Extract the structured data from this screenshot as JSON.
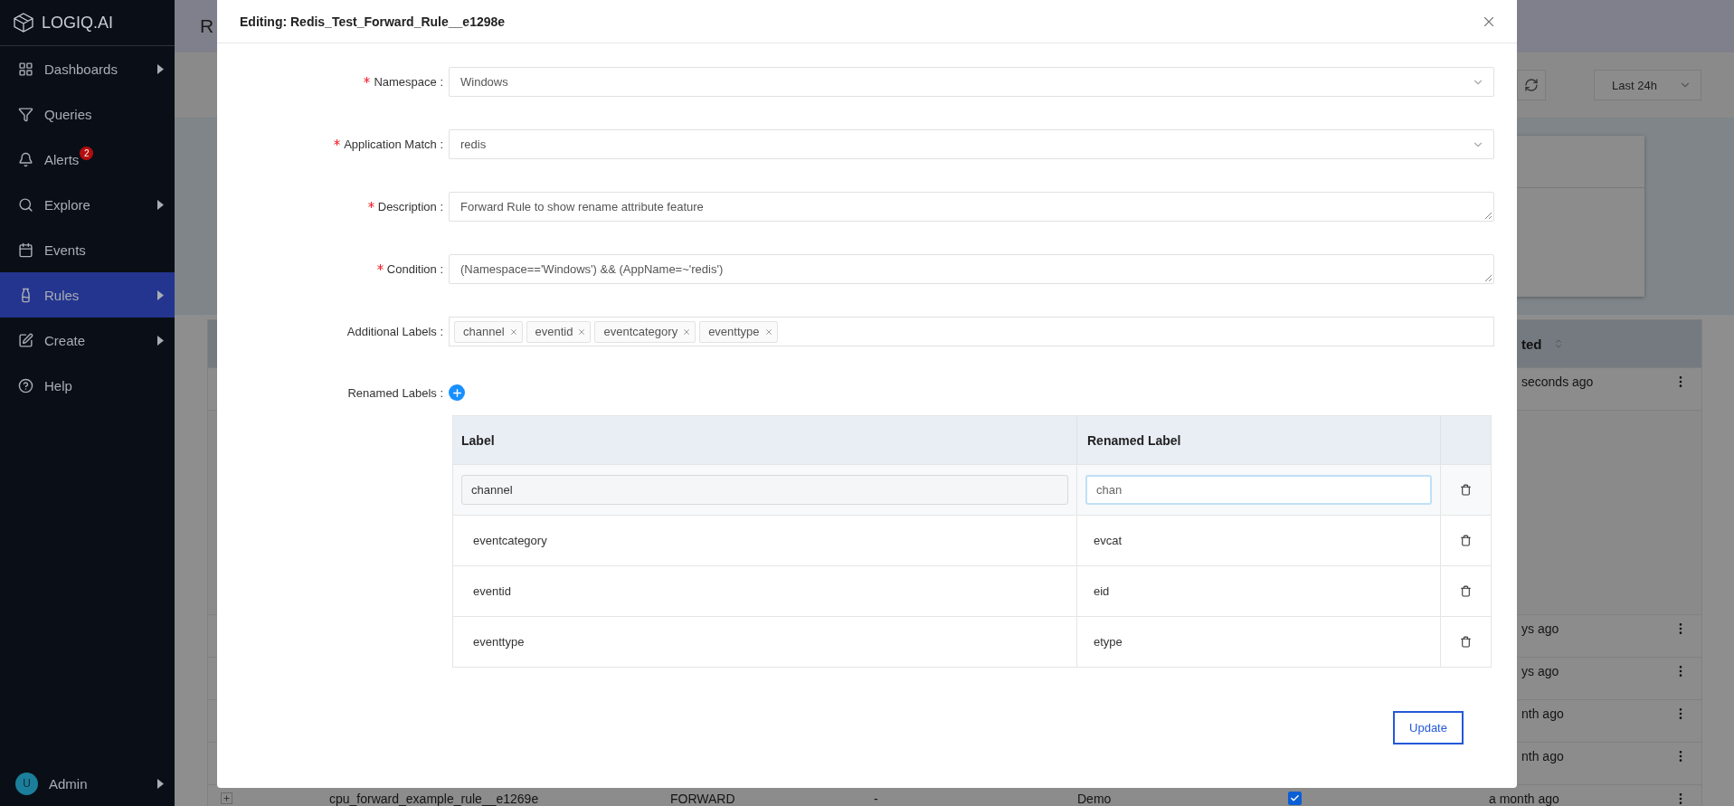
{
  "sidebar": {
    "logo": "LOGIQ.AI",
    "items": [
      {
        "label": "Dashboards",
        "submenu": true,
        "selected": false
      },
      {
        "label": "Queries",
        "submenu": false,
        "selected": false
      },
      {
        "label": "Alerts",
        "submenu": false,
        "selected": false,
        "badge": "2"
      },
      {
        "label": "Explore",
        "submenu": true,
        "selected": false
      },
      {
        "label": "Events",
        "submenu": false,
        "selected": false
      },
      {
        "label": "Rules",
        "submenu": true,
        "selected": true
      },
      {
        "label": "Create",
        "submenu": true,
        "selected": false
      },
      {
        "label": "Help",
        "submenu": false,
        "selected": false
      }
    ],
    "user": {
      "initial": "U",
      "name": "Admin",
      "submenu": true
    }
  },
  "background_page": {
    "title": "R",
    "time_range": "Last 24h",
    "table": {
      "column_header": "ted",
      "rows": [
        {
          "updated": "seconds ago",
          "expanded": true
        },
        {
          "updated": "ys ago",
          "expanded": false
        },
        {
          "updated": "ys ago",
          "expanded": false
        },
        {
          "updated": "nth ago",
          "expanded": false
        },
        {
          "updated": "nth ago",
          "expanded": false
        },
        {
          "name": "cpu_forward_example_rule__e1269e",
          "type": "FORWARD",
          "column_4": "-",
          "group": "Demo",
          "checked": true,
          "updated": "a month ago",
          "expanded": false
        }
      ]
    }
  },
  "dialog": {
    "title": "Editing: Redis_Test_Forward_Rule__e1298e",
    "fields": [
      {
        "label": "Namespace :",
        "required": true,
        "kind": "select",
        "value": "Windows"
      },
      {
        "label": "Application Match :",
        "required": true,
        "kind": "select",
        "value": "redis"
      },
      {
        "label": "Description :",
        "required": true,
        "kind": "textarea",
        "value": "Forward Rule to show rename attribute feature"
      },
      {
        "label": "Condition :",
        "required": true,
        "kind": "textarea",
        "value": "(Namespace=='Windows') && (AppName=~'redis')"
      },
      {
        "label": "Additional Labels :",
        "required": false,
        "kind": "tags",
        "tags": [
          "channel",
          "eventid",
          "eventcategory",
          "eventtype"
        ]
      }
    ],
    "renamed_labels": {
      "label": "Renamed Labels :",
      "columns": [
        "Label",
        "Renamed Label"
      ],
      "rows": [
        {
          "label": "channel",
          "renamed": "chan",
          "editing": true
        },
        {
          "label": "eventcategory",
          "renamed": "evcat",
          "editing": false
        },
        {
          "label": "eventid",
          "renamed": "eid",
          "editing": false
        },
        {
          "label": "eventtype",
          "renamed": "etype",
          "editing": false
        }
      ]
    },
    "submit": "Update"
  }
}
